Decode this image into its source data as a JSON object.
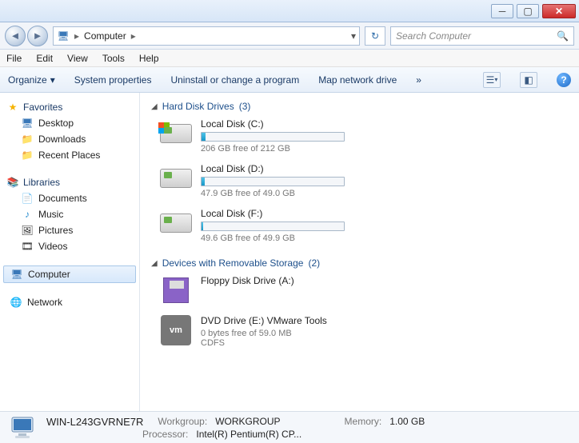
{
  "window": {
    "minimize_tip": "Minimize",
    "maximize_tip": "Maximize",
    "close_tip": "Close"
  },
  "nav": {
    "back_tip": "Back",
    "forward_tip": "Forward",
    "breadcrumb_root": "Computer",
    "refresh_tip": "Refresh",
    "search_placeholder": "Search Computer"
  },
  "menu": {
    "file": "File",
    "edit": "Edit",
    "view": "View",
    "tools": "Tools",
    "help": "Help"
  },
  "toolbar": {
    "organize": "Organize",
    "system_properties": "System properties",
    "uninstall": "Uninstall or change a program",
    "map_drive": "Map network drive",
    "more": "»",
    "view_tip": "Change view",
    "preview_tip": "Preview pane",
    "help_tip": "Help"
  },
  "sidebar": {
    "favorites": {
      "label": "Favorites",
      "items": [
        "Desktop",
        "Downloads",
        "Recent Places"
      ]
    },
    "libraries": {
      "label": "Libraries",
      "items": [
        "Documents",
        "Music",
        "Pictures",
        "Videos"
      ]
    },
    "computer": "Computer",
    "network": "Network"
  },
  "sections": {
    "hdd": {
      "title": "Hard Disk Drives",
      "count": "(3)"
    },
    "removable": {
      "title": "Devices with Removable Storage",
      "count": "(2)"
    }
  },
  "drives": {
    "c": {
      "name": "Local Disk (C:)",
      "free": "206 GB free of 212 GB",
      "fill_pct": 3
    },
    "d": {
      "name": "Local Disk (D:)",
      "free": "47.9 GB free of 49.0 GB",
      "fill_pct": 2
    },
    "f": {
      "name": "Local Disk (F:)",
      "free": "49.6 GB free of 49.9 GB",
      "fill_pct": 1
    },
    "a": {
      "name": "Floppy Disk Drive (A:)"
    },
    "e": {
      "name": "DVD Drive (E:) VMware Tools",
      "free": "0 bytes free of 59.0 MB",
      "fs": "CDFS"
    }
  },
  "status": {
    "computer_name": "WIN-L243GVRNE7R",
    "workgroup_label": "Workgroup:",
    "workgroup": "WORKGROUP",
    "memory_label": "Memory:",
    "memory": "1.00 GB",
    "processor_label": "Processor:",
    "processor": "Intel(R) Pentium(R) CP..."
  }
}
